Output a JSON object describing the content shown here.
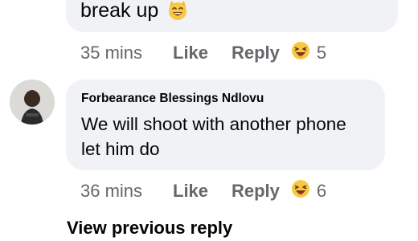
{
  "comment_top": {
    "text_end": "break up",
    "emoji_icon": "cat-face-icon",
    "meta": {
      "time": "35 mins",
      "like_label": "Like",
      "reply_label": "Reply",
      "reaction_icon": "haha-emoji-icon",
      "reaction_count": "5"
    }
  },
  "comment_second": {
    "author": "Forbearance Blessings Ndlovu",
    "avatar_icon": "avatar",
    "lines": [
      "We will shoot with another phone",
      "let him do"
    ],
    "meta": {
      "time": "36 mins",
      "like_label": "Like",
      "reply_label": "Reply",
      "reaction_icon": "haha-emoji-icon",
      "reaction_count": "6"
    }
  },
  "view_previous_reply_label": "View previous reply",
  "colors": {
    "bubble": "#f0f2f5",
    "meta_text": "#65676b",
    "text": "#050505",
    "emoji": "#f7c844"
  }
}
